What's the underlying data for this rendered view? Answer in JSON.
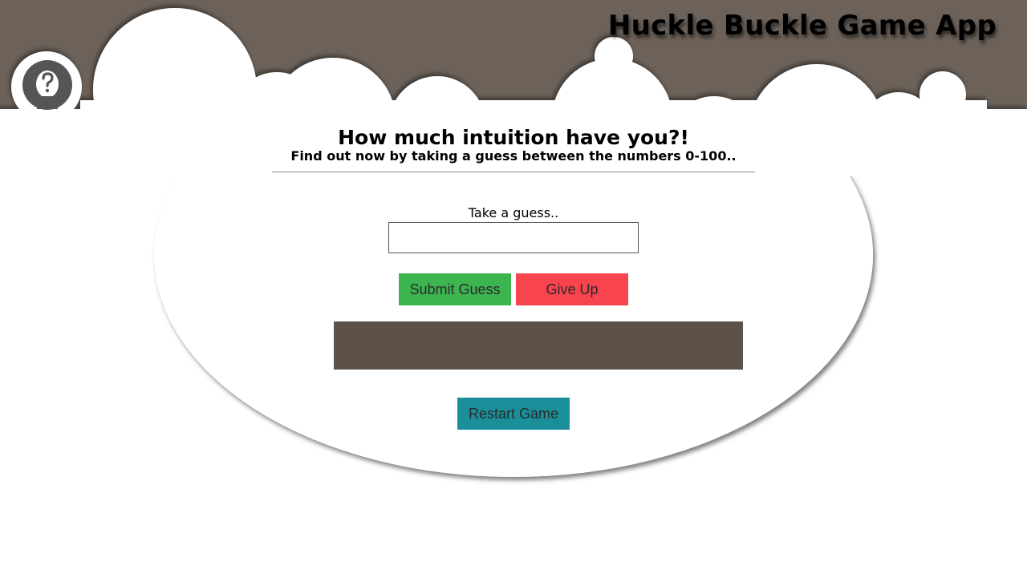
{
  "header": {
    "app_title": "Huckle Buckle Game App",
    "logo_icon": "question-head-icon",
    "background_color": "#6c625a"
  },
  "intro": {
    "headline": "How much intuition have you?!",
    "subline": "Find out now by taking a guess between the numbers 0-100.."
  },
  "guess_form": {
    "label": "Take a guess..",
    "input_value": "",
    "input_placeholder": ""
  },
  "buttons": {
    "submit_label": "Submit Guess",
    "give_up_label": "Give Up",
    "restart_label": "Restart Game"
  },
  "result": {
    "message": ""
  },
  "colors": {
    "submit": "#3cb44f",
    "give_up": "#f7444f",
    "restart": "#1a8f99",
    "result_box": "#5d524a"
  }
}
